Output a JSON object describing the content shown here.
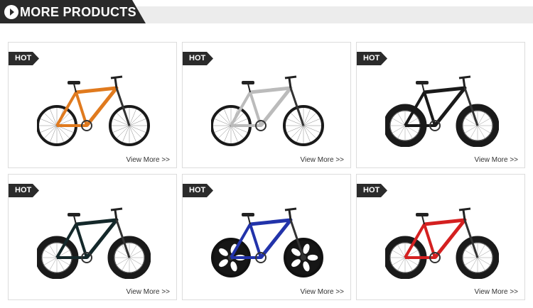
{
  "header": {
    "title": "MORE PRODUCTS"
  },
  "products": [
    {
      "badge": "HOT",
      "link": "View More >>",
      "frame_color": "#e07a1e",
      "wheel_type": "road"
    },
    {
      "badge": "HOT",
      "link": "View More >>",
      "frame_color": "#f2f2f2",
      "wheel_type": "road"
    },
    {
      "badge": "HOT",
      "link": "View More >>",
      "frame_color": "#1a1a1a",
      "wheel_type": "fat"
    },
    {
      "badge": "HOT",
      "link": "View More >>",
      "frame_color": "#14282a",
      "wheel_type": "fat"
    },
    {
      "badge": "HOT",
      "link": "View More >>",
      "frame_color": "#2233aa",
      "wheel_type": "mag"
    },
    {
      "badge": "HOT",
      "link": "View More >>",
      "frame_color": "#d42020",
      "wheel_type": "fat"
    }
  ]
}
